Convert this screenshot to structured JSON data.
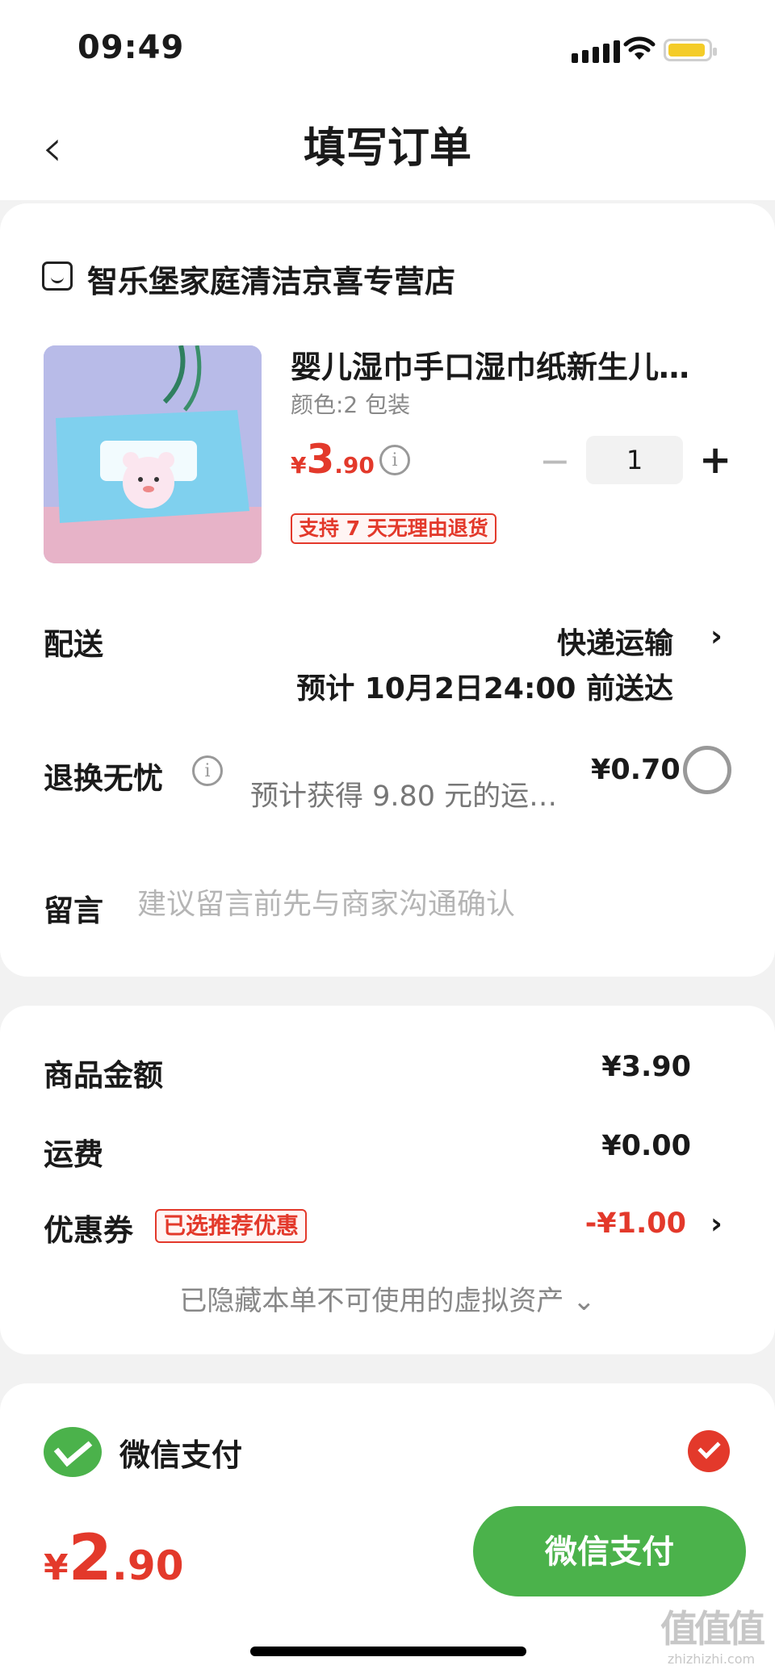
{
  "status_bar": {
    "time": "09:49"
  },
  "nav": {
    "back_glyph": "‹",
    "title": "填写订单"
  },
  "store": {
    "name": "智乐堡家庭清洁京喜专营店",
    "icon": "store-icon"
  },
  "product": {
    "title": "婴儿湿巾手口湿巾纸新生儿…",
    "spec": "颜色:2 包装",
    "price": {
      "currency": "¥",
      "int": "3",
      "dec": ".90"
    },
    "quantity": "1",
    "minus_glyph": "−",
    "plus_glyph": "+",
    "return_badge": "支持 7 天无理由退货"
  },
  "shipping": {
    "label": "配送",
    "method": "快递运输",
    "chevron": "›",
    "eta": "预计 10月2日24:00 前送达"
  },
  "return_worry": {
    "label": "退换无忧",
    "desc": "预计获得 9.80 元的运…",
    "price": "¥0.70",
    "selected": false
  },
  "message": {
    "label": "留言",
    "placeholder": "建议留言前先与商家沟通确认",
    "value": ""
  },
  "summary": {
    "goods_label": "商品金额",
    "goods_value": "¥3.90",
    "freight_label": "运费",
    "freight_value": "¥0.00",
    "coupon_label": "优惠券",
    "coupon_badge": "已选推荐优惠",
    "coupon_value": "-¥1.00",
    "coupon_chevron": "›",
    "hidden_assets": "已隐藏本单不可使用的虚拟资产 ⌄"
  },
  "payment": {
    "method": "微信支付",
    "icon": "wechat-pay-icon",
    "selected": true
  },
  "footer": {
    "total": {
      "currency": "¥",
      "int": "2",
      "dec": ".90"
    },
    "pay_button": "微信支付"
  },
  "watermark": {
    "big": "值值值",
    "small": "zhizhizhi.com"
  },
  "colors": {
    "accent_red": "#e3392b",
    "wechat_green": "#4bb24b",
    "background": "#f2f2f2"
  }
}
